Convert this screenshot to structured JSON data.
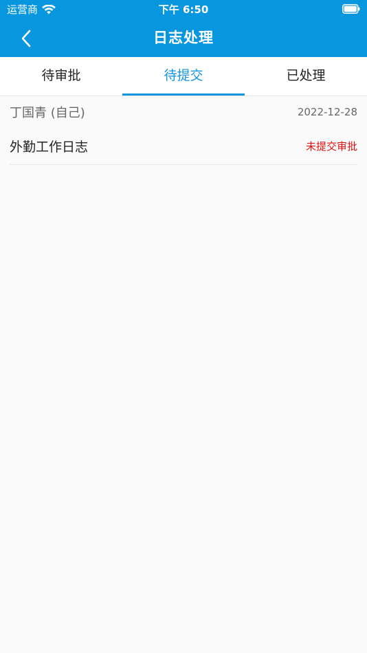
{
  "status_bar": {
    "carrier": "运营商",
    "time": "下午 6:50"
  },
  "nav": {
    "title": "日志处理"
  },
  "tabs": [
    {
      "label": "待审批",
      "active": false
    },
    {
      "label": "待提交",
      "active": true
    },
    {
      "label": "已处理",
      "active": false
    }
  ],
  "items": [
    {
      "person": "丁国青 (自己)",
      "date": "2022-12-28",
      "title": "外勤工作日志",
      "status": "未提交审批",
      "status_color": "#e3100f"
    }
  ],
  "colors": {
    "header": "#0896de",
    "accent": "#1296db",
    "status_red": "#e3100f"
  },
  "icons": {
    "back": "chevron-left-icon",
    "wifi": "wifi-icon",
    "battery": "battery-icon"
  }
}
